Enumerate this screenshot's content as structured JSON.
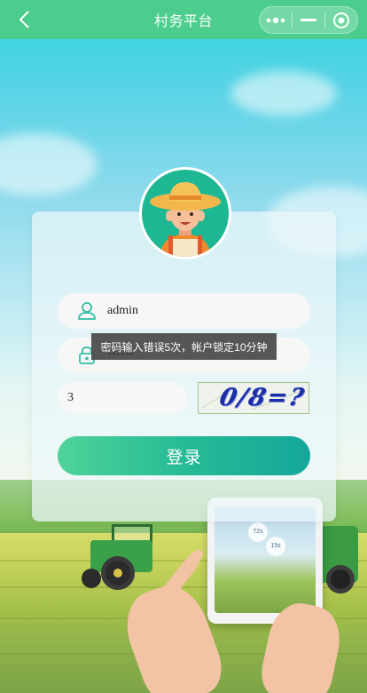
{
  "navbar": {
    "title": "村务平台",
    "back_icon": "chevron-left-icon",
    "more_icon": "more-dots-icon",
    "minimize_icon": "minus-icon",
    "close_icon": "target-circle-icon"
  },
  "login": {
    "username_value": "admin",
    "password_value": "••••••",
    "captcha_input_value": "3",
    "captcha_image_text": "0/8=?",
    "submit_label": "登录",
    "user_icon": "user-icon",
    "lock_icon": "lock-icon"
  },
  "toast": {
    "message": "密码输入错误5次，帐户锁定10分钟"
  },
  "illustration": {
    "tablet_bubble_1": "72s",
    "tablet_bubble_2": "15s"
  },
  "colors": {
    "navbar": "#4ccd8d",
    "button_start": "#4fd39a",
    "button_end": "#14a79a",
    "toast_bg": "#484848"
  }
}
